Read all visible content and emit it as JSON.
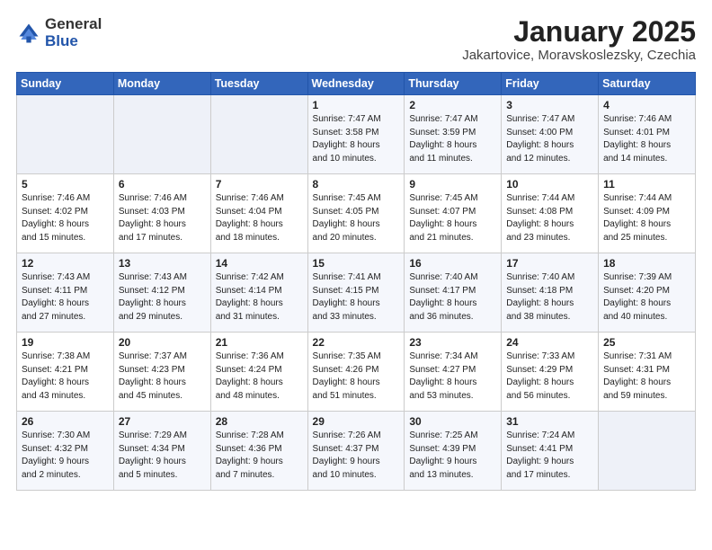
{
  "header": {
    "logo_general": "General",
    "logo_blue": "Blue",
    "month_title": "January 2025",
    "location": "Jakartovice, Moravskoslezsky, Czechia"
  },
  "days_of_week": [
    "Sunday",
    "Monday",
    "Tuesday",
    "Wednesday",
    "Thursday",
    "Friday",
    "Saturday"
  ],
  "weeks": [
    [
      {
        "day": "",
        "info": ""
      },
      {
        "day": "",
        "info": ""
      },
      {
        "day": "",
        "info": ""
      },
      {
        "day": "1",
        "info": "Sunrise: 7:47 AM\nSunset: 3:58 PM\nDaylight: 8 hours\nand 10 minutes."
      },
      {
        "day": "2",
        "info": "Sunrise: 7:47 AM\nSunset: 3:59 PM\nDaylight: 8 hours\nand 11 minutes."
      },
      {
        "day": "3",
        "info": "Sunrise: 7:47 AM\nSunset: 4:00 PM\nDaylight: 8 hours\nand 12 minutes."
      },
      {
        "day": "4",
        "info": "Sunrise: 7:46 AM\nSunset: 4:01 PM\nDaylight: 8 hours\nand 14 minutes."
      }
    ],
    [
      {
        "day": "5",
        "info": "Sunrise: 7:46 AM\nSunset: 4:02 PM\nDaylight: 8 hours\nand 15 minutes."
      },
      {
        "day": "6",
        "info": "Sunrise: 7:46 AM\nSunset: 4:03 PM\nDaylight: 8 hours\nand 17 minutes."
      },
      {
        "day": "7",
        "info": "Sunrise: 7:46 AM\nSunset: 4:04 PM\nDaylight: 8 hours\nand 18 minutes."
      },
      {
        "day": "8",
        "info": "Sunrise: 7:45 AM\nSunset: 4:05 PM\nDaylight: 8 hours\nand 20 minutes."
      },
      {
        "day": "9",
        "info": "Sunrise: 7:45 AM\nSunset: 4:07 PM\nDaylight: 8 hours\nand 21 minutes."
      },
      {
        "day": "10",
        "info": "Sunrise: 7:44 AM\nSunset: 4:08 PM\nDaylight: 8 hours\nand 23 minutes."
      },
      {
        "day": "11",
        "info": "Sunrise: 7:44 AM\nSunset: 4:09 PM\nDaylight: 8 hours\nand 25 minutes."
      }
    ],
    [
      {
        "day": "12",
        "info": "Sunrise: 7:43 AM\nSunset: 4:11 PM\nDaylight: 8 hours\nand 27 minutes."
      },
      {
        "day": "13",
        "info": "Sunrise: 7:43 AM\nSunset: 4:12 PM\nDaylight: 8 hours\nand 29 minutes."
      },
      {
        "day": "14",
        "info": "Sunrise: 7:42 AM\nSunset: 4:14 PM\nDaylight: 8 hours\nand 31 minutes."
      },
      {
        "day": "15",
        "info": "Sunrise: 7:41 AM\nSunset: 4:15 PM\nDaylight: 8 hours\nand 33 minutes."
      },
      {
        "day": "16",
        "info": "Sunrise: 7:40 AM\nSunset: 4:17 PM\nDaylight: 8 hours\nand 36 minutes."
      },
      {
        "day": "17",
        "info": "Sunrise: 7:40 AM\nSunset: 4:18 PM\nDaylight: 8 hours\nand 38 minutes."
      },
      {
        "day": "18",
        "info": "Sunrise: 7:39 AM\nSunset: 4:20 PM\nDaylight: 8 hours\nand 40 minutes."
      }
    ],
    [
      {
        "day": "19",
        "info": "Sunrise: 7:38 AM\nSunset: 4:21 PM\nDaylight: 8 hours\nand 43 minutes."
      },
      {
        "day": "20",
        "info": "Sunrise: 7:37 AM\nSunset: 4:23 PM\nDaylight: 8 hours\nand 45 minutes."
      },
      {
        "day": "21",
        "info": "Sunrise: 7:36 AM\nSunset: 4:24 PM\nDaylight: 8 hours\nand 48 minutes."
      },
      {
        "day": "22",
        "info": "Sunrise: 7:35 AM\nSunset: 4:26 PM\nDaylight: 8 hours\nand 51 minutes."
      },
      {
        "day": "23",
        "info": "Sunrise: 7:34 AM\nSunset: 4:27 PM\nDaylight: 8 hours\nand 53 minutes."
      },
      {
        "day": "24",
        "info": "Sunrise: 7:33 AM\nSunset: 4:29 PM\nDaylight: 8 hours\nand 56 minutes."
      },
      {
        "day": "25",
        "info": "Sunrise: 7:31 AM\nSunset: 4:31 PM\nDaylight: 8 hours\nand 59 minutes."
      }
    ],
    [
      {
        "day": "26",
        "info": "Sunrise: 7:30 AM\nSunset: 4:32 PM\nDaylight: 9 hours\nand 2 minutes."
      },
      {
        "day": "27",
        "info": "Sunrise: 7:29 AM\nSunset: 4:34 PM\nDaylight: 9 hours\nand 5 minutes."
      },
      {
        "day": "28",
        "info": "Sunrise: 7:28 AM\nSunset: 4:36 PM\nDaylight: 9 hours\nand 7 minutes."
      },
      {
        "day": "29",
        "info": "Sunrise: 7:26 AM\nSunset: 4:37 PM\nDaylight: 9 hours\nand 10 minutes."
      },
      {
        "day": "30",
        "info": "Sunrise: 7:25 AM\nSunset: 4:39 PM\nDaylight: 9 hours\nand 13 minutes."
      },
      {
        "day": "31",
        "info": "Sunrise: 7:24 AM\nSunset: 4:41 PM\nDaylight: 9 hours\nand 17 minutes."
      },
      {
        "day": "",
        "info": ""
      }
    ]
  ]
}
